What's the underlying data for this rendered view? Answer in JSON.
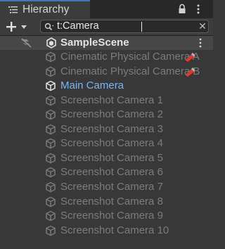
{
  "panel": {
    "title": "Hierarchy",
    "lock_icon": "lock-icon",
    "menu_icon": "kebab-menu-icon",
    "tab_icon": "hierarchy-list-icon"
  },
  "toolbar": {
    "create_icon": "plus-icon",
    "create_dropdown_icon": "triangle-down-icon",
    "search": {
      "value": "t:Camera",
      "icon": "search-icon",
      "clear_icon": "close-icon"
    }
  },
  "scene": {
    "name": "SampleScene",
    "icon": "unity-logo-icon",
    "toggle_icon": "scene-visibility-icon",
    "menu_icon": "kebab-menu-icon"
  },
  "items": [
    {
      "label": "Cinematic Physical Camera A",
      "state": "dim",
      "icon": "cube-icon",
      "warning_icon": "warning-pencil-icon"
    },
    {
      "label": "Cinematic Physical Camera B",
      "state": "dim",
      "icon": "cube-icon",
      "warning_icon": "warning-pencil-icon"
    },
    {
      "label": "Main Camera",
      "state": "active",
      "icon": "cube-icon"
    },
    {
      "label": "Screenshot Camera 1",
      "state": "dim",
      "icon": "cube-icon"
    },
    {
      "label": "Screenshot Camera 2",
      "state": "dim",
      "icon": "cube-icon"
    },
    {
      "label": "Screenshot Camera 3",
      "state": "dim",
      "icon": "cube-icon"
    },
    {
      "label": "Screenshot Camera 4",
      "state": "dim",
      "icon": "cube-icon"
    },
    {
      "label": "Screenshot Camera 5",
      "state": "dim",
      "icon": "cube-icon"
    },
    {
      "label": "Screenshot Camera 6",
      "state": "dim",
      "icon": "cube-icon"
    },
    {
      "label": "Screenshot Camera 7",
      "state": "dim",
      "icon": "cube-icon"
    },
    {
      "label": "Screenshot Camera 8",
      "state": "dim",
      "icon": "cube-icon"
    },
    {
      "label": "Screenshot Camera 9",
      "state": "dim",
      "icon": "cube-icon"
    },
    {
      "label": "Screenshot Camera 10",
      "state": "dim",
      "icon": "cube-icon"
    }
  ],
  "colors": {
    "background": "#383838",
    "active_text": "#7cb4f2",
    "dim_text": "#7c7c7c",
    "accent_tab": "#3a79bb",
    "warning": "#d93b2b"
  }
}
